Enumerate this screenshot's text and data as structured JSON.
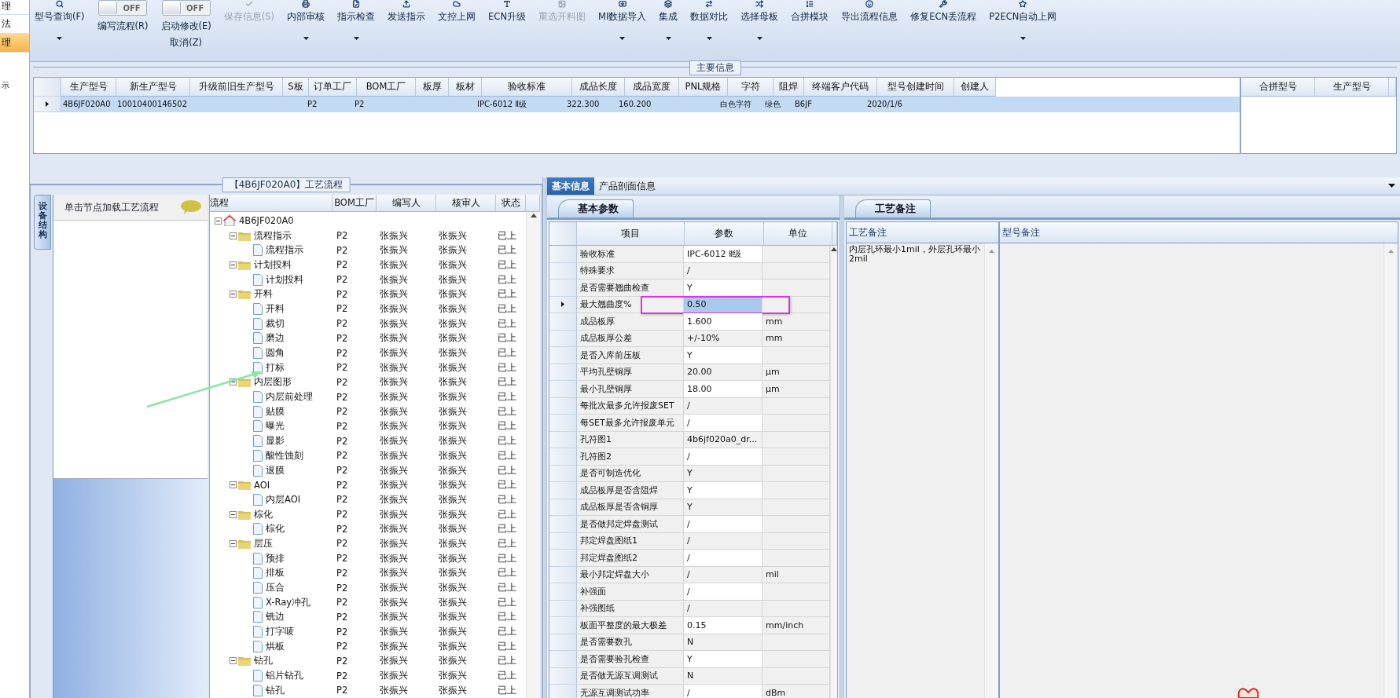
{
  "side_menu": [
    {
      "label": "理",
      "selected": false
    },
    {
      "label": "法",
      "selected": false
    },
    {
      "label": "理",
      "selected": true
    },
    {
      "label": "示",
      "selected": false
    }
  ],
  "toolbar": [
    {
      "kind": "button",
      "label": "型号查询(F)",
      "menu": true,
      "disabled": false
    },
    {
      "kind": "toggle",
      "switch_label": "OFF",
      "on": false,
      "label": "编写流程(R)"
    },
    {
      "kind": "toggle",
      "switch_label": "OFF",
      "on": false,
      "label": "启动修改(E)",
      "sub_label": "取消(Z)"
    },
    {
      "kind": "button",
      "label": "保存信息(S)",
      "menu": false,
      "disabled": true
    },
    {
      "kind": "button",
      "label": "内部审核",
      "menu": true,
      "disabled": false
    },
    {
      "kind": "button",
      "label": "指示检查",
      "menu": true,
      "disabled": false
    },
    {
      "kind": "button",
      "label": "发送指示",
      "menu": false,
      "disabled": false
    },
    {
      "kind": "button",
      "label": "文控上网",
      "menu": false,
      "disabled": false
    },
    {
      "kind": "button",
      "label": "ECN升级",
      "menu": false,
      "disabled": false
    },
    {
      "kind": "button",
      "label": "重选开料图",
      "menu": false,
      "disabled": true
    },
    {
      "kind": "button",
      "label": "MI数据导入",
      "menu": true,
      "disabled": false
    },
    {
      "kind": "button",
      "label": "集成",
      "menu": true,
      "disabled": false
    },
    {
      "kind": "button",
      "label": "数据对比",
      "menu": true,
      "disabled": false
    },
    {
      "kind": "button",
      "label": "选择母板",
      "menu": true,
      "disabled": false
    },
    {
      "kind": "button",
      "label": "合拼模块",
      "menu": false,
      "disabled": false
    },
    {
      "kind": "button",
      "label": "导出流程信息",
      "menu": false,
      "disabled": false
    },
    {
      "kind": "button",
      "label": "修复ECN丢流程",
      "menu": false,
      "disabled": false
    },
    {
      "kind": "button",
      "label": "P2ECN自动上网",
      "menu": true,
      "disabled": false
    }
  ],
  "main_info": {
    "title": "主要信息",
    "columns": [
      "生产型号",
      "新生产型号",
      "升级前旧生产型号",
      "S板",
      "订单工厂",
      "BOM工厂",
      "板厚",
      "板材",
      "验收标准",
      "成品长度",
      "成品宽度",
      "PNL规格",
      "字符",
      "阻焊",
      "终端客户代码",
      "型号创建时间",
      "创建人"
    ],
    "rows": [
      {
        "selected": true,
        "cells": [
          "4B6JF020A0",
          "10010400146502",
          "",
          "",
          "P2",
          "P2",
          "",
          "",
          "IPC-6012 Ⅱ级",
          "322.300",
          "160.200",
          "",
          "白色字符",
          "绿色",
          "B6JF",
          "2020/1/6",
          ""
        ]
      }
    ],
    "side_columns": [
      "合拼型号",
      "生产型号"
    ]
  },
  "process_panel": {
    "title": "【4B6JF020A0】工艺流程",
    "side_tab": "设备结构",
    "hint": "单击节点加载工艺流程",
    "columns": [
      "流程",
      "BOM工厂",
      "编写人",
      "核审人",
      "状态"
    ],
    "tree": {
      "label": "4B6JF020A0",
      "expanded": true,
      "children": [
        {
          "label": "流程指示",
          "bom": "P2",
          "writer": "张振兴",
          "reviewer": "张振兴",
          "status": "已上",
          "expanded": true,
          "children": [
            {
              "label": "流程指示",
              "bom": "P2",
              "writer": "张振兴",
              "reviewer": "张振兴",
              "status": "已上"
            }
          ]
        },
        {
          "label": "计划投料",
          "bom": "P2",
          "writer": "张振兴",
          "reviewer": "张振兴",
          "status": "已上",
          "expanded": true,
          "children": [
            {
              "label": "计划投料",
              "bom": "P2",
              "writer": "张振兴",
              "reviewer": "张振兴",
              "status": "已上"
            }
          ]
        },
        {
          "label": "开料",
          "bom": "P2",
          "writer": "张振兴",
          "reviewer": "张振兴",
          "status": "已上",
          "expanded": true,
          "children": [
            {
              "label": "开料",
              "bom": "P2",
              "writer": "张振兴",
              "reviewer": "张振兴",
              "status": "已上"
            },
            {
              "label": "裁切",
              "bom": "P2",
              "writer": "张振兴",
              "reviewer": "张振兴",
              "status": "已上"
            },
            {
              "label": "磨边",
              "bom": "P2",
              "writer": "张振兴",
              "reviewer": "张振兴",
              "status": "已上"
            },
            {
              "label": "圆角",
              "bom": "P2",
              "writer": "张振兴",
              "reviewer": "张振兴",
              "status": "已上"
            },
            {
              "label": "打标",
              "bom": "P2",
              "writer": "张振兴",
              "reviewer": "张振兴",
              "status": "已上"
            }
          ]
        },
        {
          "label": "内层图形",
          "bom": "P2",
          "writer": "张振兴",
          "reviewer": "张振兴",
          "status": "已上",
          "expanded": true,
          "children": [
            {
              "label": "内层前处理",
              "bom": "P2",
              "writer": "张振兴",
              "reviewer": "张振兴",
              "status": "已上"
            },
            {
              "label": "贴膜",
              "bom": "P2",
              "writer": "张振兴",
              "reviewer": "张振兴",
              "status": "已上"
            },
            {
              "label": "曝光",
              "bom": "P2",
              "writer": "张振兴",
              "reviewer": "张振兴",
              "status": "已上"
            },
            {
              "label": "显影",
              "bom": "P2",
              "writer": "张振兴",
              "reviewer": "张振兴",
              "status": "已上"
            },
            {
              "label": "酸性蚀刻",
              "bom": "P2",
              "writer": "张振兴",
              "reviewer": "张振兴",
              "status": "已上"
            },
            {
              "label": "退膜",
              "bom": "P2",
              "writer": "张振兴",
              "reviewer": "张振兴",
              "status": "已上"
            }
          ]
        },
        {
          "label": "AOI",
          "bom": "P2",
          "writer": "张振兴",
          "reviewer": "张振兴",
          "status": "已上",
          "expanded": true,
          "children": [
            {
              "label": "内层AOI",
              "bom": "P2",
              "writer": "张振兴",
              "reviewer": "张振兴",
              "status": "已上"
            }
          ]
        },
        {
          "label": "棕化",
          "bom": "P2",
          "writer": "张振兴",
          "reviewer": "张振兴",
          "status": "已上",
          "expanded": true,
          "children": [
            {
              "label": "棕化",
              "bom": "P2",
              "writer": "张振兴",
              "reviewer": "张振兴",
              "status": "已上"
            }
          ]
        },
        {
          "label": "层压",
          "bom": "P2",
          "writer": "张振兴",
          "reviewer": "张振兴",
          "status": "已上",
          "expanded": true,
          "children": [
            {
              "label": "预排",
              "bom": "P2",
              "writer": "张振兴",
              "reviewer": "张振兴",
              "status": "已上"
            },
            {
              "label": "排板",
              "bom": "P2",
              "writer": "张振兴",
              "reviewer": "张振兴",
              "status": "已上"
            },
            {
              "label": "压合",
              "bom": "P2",
              "writer": "张振兴",
              "reviewer": "张振兴",
              "status": "已上"
            },
            {
              "label": "X-Ray冲孔",
              "bom": "P2",
              "writer": "张振兴",
              "reviewer": "张振兴",
              "status": "已上"
            },
            {
              "label": "铣边",
              "bom": "P2",
              "writer": "张振兴",
              "reviewer": "张振兴",
              "status": "已上"
            },
            {
              "label": "打字唛",
              "bom": "P2",
              "writer": "张振兴",
              "reviewer": "张振兴",
              "status": "已上"
            },
            {
              "label": "烘板",
              "bom": "P2",
              "writer": "张振兴",
              "reviewer": "张振兴",
              "status": "已上"
            }
          ]
        },
        {
          "label": "钻孔",
          "bom": "P2",
          "writer": "张振兴",
          "reviewer": "张振兴",
          "status": "已上",
          "expanded": true,
          "children": [
            {
              "label": "铝片钻孔",
              "bom": "P2",
              "writer": "张振兴",
              "reviewer": "张振兴",
              "status": "已上"
            },
            {
              "label": "钻孔",
              "bom": "P2",
              "writer": "张振兴",
              "reviewer": "张振兴",
              "status": "已上"
            }
          ]
        }
      ]
    }
  },
  "detail": {
    "tabs": [
      {
        "label": "基本信息",
        "selected": true
      },
      {
        "label": "产品剖面信息",
        "selected": false
      }
    ],
    "params": {
      "tab": "基本参数",
      "columns": [
        "项目",
        "参数",
        "单位"
      ],
      "rows": [
        {
          "item": "验收标准",
          "value": "IPC-6012 Ⅱ级",
          "unit": "",
          "selected": false
        },
        {
          "item": "特殊要求",
          "value": "/",
          "unit": "",
          "selected": false
        },
        {
          "item": "是否需要翘曲检查",
          "value": "Y",
          "unit": "",
          "selected": false
        },
        {
          "item": "最大翘曲度%",
          "value": "0.50",
          "unit": "",
          "selected": true
        },
        {
          "item": "成品板厚",
          "value": "1.600",
          "unit": "mm",
          "selected": false
        },
        {
          "item": "成品板厚公差",
          "value": "+/-10%",
          "unit": "mm",
          "selected": false
        },
        {
          "item": "是否入库前压板",
          "value": "Y",
          "unit": "",
          "selected": false
        },
        {
          "item": "平均孔壁铜厚",
          "value": "20.00",
          "unit": "μm",
          "selected": false
        },
        {
          "item": "最小孔壁铜厚",
          "value": "18.00",
          "unit": "μm",
          "selected": false
        },
        {
          "item": "每批次最多允许报废SET",
          "value": "/",
          "unit": "",
          "selected": false
        },
        {
          "item": "每SET最多允许报废单元",
          "value": "/",
          "unit": "",
          "selected": false
        },
        {
          "item": "孔符图1",
          "value": "4b6jf020a0_dr...",
          "unit": "",
          "selected": false
        },
        {
          "item": "孔符图2",
          "value": "/",
          "unit": "",
          "selected": false
        },
        {
          "item": "是否可制造优化",
          "value": "Y",
          "unit": "",
          "selected": false
        },
        {
          "item": "成品板厚是否含阻焊",
          "value": "Y",
          "unit": "",
          "selected": false
        },
        {
          "item": "成品板厚是否含铜厚",
          "value": "Y",
          "unit": "",
          "selected": false
        },
        {
          "item": "是否做邦定焊盘测试",
          "value": "/",
          "unit": "",
          "selected": false
        },
        {
          "item": "邦定焊盘图纸1",
          "value": "/",
          "unit": "",
          "selected": false
        },
        {
          "item": "邦定焊盘图纸2",
          "value": "/",
          "unit": "",
          "selected": false
        },
        {
          "item": "最小邦定焊盘大小",
          "value": "/",
          "unit": "mil",
          "selected": false
        },
        {
          "item": "补强面",
          "value": "/",
          "unit": "",
          "selected": false
        },
        {
          "item": "补强图纸",
          "value": "/",
          "unit": "",
          "selected": false
        },
        {
          "item": "板面平整度的最大极差",
          "value": "0.15",
          "unit": "mm/inch",
          "selected": false
        },
        {
          "item": "是否需要数孔",
          "value": "N",
          "unit": "",
          "selected": false
        },
        {
          "item": "是否需要验孔检查",
          "value": "Y",
          "unit": "",
          "selected": false
        },
        {
          "item": "是否做无源互调测试",
          "value": "N",
          "unit": "",
          "selected": false
        },
        {
          "item": "无源互调测试功率",
          "value": "/",
          "unit": "dBm",
          "selected": false
        }
      ]
    },
    "notes": {
      "tab": "工艺备注",
      "columns": [
        "工艺备注",
        "型号备注"
      ],
      "process_note": "内层孔环最小1mil，外层孔环最小2mil"
    }
  }
}
